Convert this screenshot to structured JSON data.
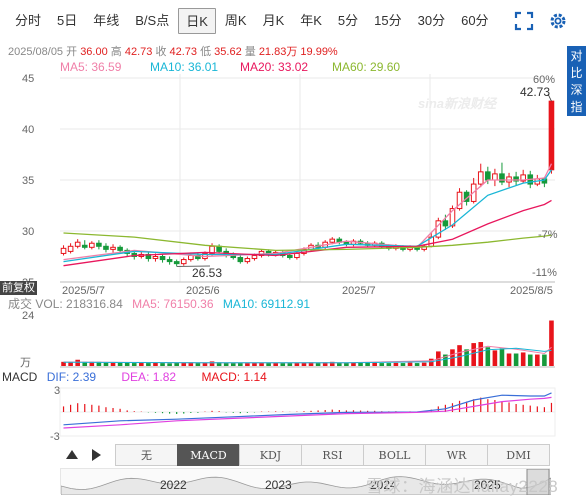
{
  "tabs": [
    {
      "label": "分时"
    },
    {
      "label": "5日"
    },
    {
      "label": "年线"
    },
    {
      "label": "B/S点"
    },
    {
      "label": "日K"
    },
    {
      "label": "周K"
    },
    {
      "label": "月K"
    },
    {
      "label": "年K"
    },
    {
      "label": "5分"
    },
    {
      "label": "15分"
    },
    {
      "label": "30分"
    },
    {
      "label": "60分"
    }
  ],
  "active_tab": "日K",
  "icons": {
    "expand": "expand-icon",
    "settings": "settings-icon",
    "prev": "triangle-up-icon",
    "next": "triangle-right-icon"
  },
  "info": {
    "date": "2025/08/05",
    "open_label": "开",
    "open": "36.00",
    "high_label": "高",
    "high": "42.73",
    "close_label": "收",
    "close": "42.73",
    "low_label": "低",
    "low": "35.62",
    "vol_label": "量",
    "vol": "21.83万",
    "change": "19.99%"
  },
  "ma_legend": [
    {
      "text": "MA5: 36.59",
      "color": "#f07fa8"
    },
    {
      "text": "MA10: 36.01",
      "color": "#19b6d6"
    },
    {
      "text": "MA20: 33.02",
      "color": "#e8175d"
    },
    {
      "text": "MA60: 29.60",
      "color": "#8cb830"
    }
  ],
  "side_button": "对比深指",
  "price_axis": [
    "45",
    "40",
    "35",
    "30",
    "25"
  ],
  "pct_axis": [
    "60%",
    "-7%",
    "-11%"
  ],
  "annotations": {
    "high_label": "42.73",
    "low_label": "26.53",
    "logo_text": "sina新浪财经"
  },
  "date_axis": [
    "2025/5/7",
    "2025/6",
    "2025/7",
    "2025/8/5"
  ],
  "fuquan_label": "前复权",
  "volume_legend": {
    "prefix": "成交",
    "vol": "VOL: 218316.84",
    "ma5": "MA5: 76150.36",
    "ma10": "MA10: 69112.91"
  },
  "volume_axis": {
    "top": "24",
    "unit": "万"
  },
  "macd_legend": {
    "title": "MACD",
    "dif": "DIF: 2.39",
    "dea": "DEA: 1.82",
    "macd": "MACD: 1.14"
  },
  "macd_axis": [
    "3",
    "-3"
  ],
  "indicators": [
    "无",
    "MACD",
    "KDJ",
    "RSI",
    "BOLL",
    "WR",
    "DMI"
  ],
  "active_indicator": "MACD",
  "overview_years": [
    "2022",
    "2023",
    "2024",
    "2025"
  ],
  "watermark": "雪球：海涵达hailay2228",
  "colors": {
    "up": "#e8141b",
    "down": "#169a3b",
    "accent": "#1961b5"
  },
  "chart_data": {
    "type": "candlestick",
    "candles": [
      {
        "o": 27.8,
        "c": 28.3,
        "h": 28.6,
        "l": 27.6
      },
      {
        "o": 28.0,
        "c": 28.5,
        "h": 28.8,
        "l": 27.8
      },
      {
        "o": 28.5,
        "c": 28.9,
        "h": 29.2,
        "l": 28.3
      },
      {
        "o": 28.6,
        "c": 28.4,
        "h": 29.1,
        "l": 28.2
      },
      {
        "o": 28.4,
        "c": 28.8,
        "h": 29.0,
        "l": 28.2
      },
      {
        "o": 28.8,
        "c": 28.5,
        "h": 29.1,
        "l": 28.2
      },
      {
        "o": 28.5,
        "c": 28.2,
        "h": 28.8,
        "l": 27.9
      },
      {
        "o": 28.2,
        "c": 28.4,
        "h": 28.7,
        "l": 27.9
      },
      {
        "o": 28.4,
        "c": 28.1,
        "h": 28.6,
        "l": 27.8
      },
      {
        "o": 28.1,
        "c": 27.8,
        "h": 28.3,
        "l": 27.5
      },
      {
        "o": 27.8,
        "c": 27.5,
        "h": 28.1,
        "l": 27.2
      },
      {
        "o": 27.5,
        "c": 27.7,
        "h": 28.0,
        "l": 27.3
      },
      {
        "o": 27.7,
        "c": 27.3,
        "h": 27.9,
        "l": 27.0
      },
      {
        "o": 27.3,
        "c": 27.5,
        "h": 27.8,
        "l": 27.0
      },
      {
        "o": 27.5,
        "c": 27.2,
        "h": 27.7,
        "l": 26.9
      },
      {
        "o": 27.2,
        "c": 27.0,
        "h": 27.5,
        "l": 26.7
      },
      {
        "o": 27.0,
        "c": 26.8,
        "h": 27.2,
        "l": 26.53
      },
      {
        "o": 26.8,
        "c": 27.2,
        "h": 27.4,
        "l": 26.6
      },
      {
        "o": 27.2,
        "c": 27.6,
        "h": 27.9,
        "l": 27.0
      },
      {
        "o": 27.6,
        "c": 27.3,
        "h": 27.9,
        "l": 27.1
      },
      {
        "o": 27.3,
        "c": 27.8,
        "h": 28.0,
        "l": 27.1
      },
      {
        "o": 27.8,
        "c": 28.5,
        "h": 28.8,
        "l": 27.6
      },
      {
        "o": 28.5,
        "c": 28.0,
        "h": 28.7,
        "l": 27.8
      },
      {
        "o": 28.0,
        "c": 27.6,
        "h": 28.3,
        "l": 27.4
      },
      {
        "o": 27.6,
        "c": 27.4,
        "h": 27.9,
        "l": 27.2
      },
      {
        "o": 27.4,
        "c": 27.0,
        "h": 27.6,
        "l": 26.8
      },
      {
        "o": 27.0,
        "c": 27.3,
        "h": 27.5,
        "l": 26.8
      },
      {
        "o": 27.3,
        "c": 27.6,
        "h": 27.8,
        "l": 27.1
      },
      {
        "o": 27.6,
        "c": 28.0,
        "h": 28.2,
        "l": 27.4
      },
      {
        "o": 28.0,
        "c": 27.7,
        "h": 28.2,
        "l": 27.5
      },
      {
        "o": 27.7,
        "c": 27.9,
        "h": 28.1,
        "l": 27.5
      },
      {
        "o": 27.9,
        "c": 27.6,
        "h": 28.1,
        "l": 27.4
      },
      {
        "o": 27.6,
        "c": 27.4,
        "h": 27.8,
        "l": 27.2
      },
      {
        "o": 27.4,
        "c": 27.8,
        "h": 28.0,
        "l": 27.2
      },
      {
        "o": 27.8,
        "c": 28.2,
        "h": 28.4,
        "l": 27.6
      },
      {
        "o": 28.2,
        "c": 28.6,
        "h": 28.8,
        "l": 28.0
      },
      {
        "o": 28.6,
        "c": 28.4,
        "h": 28.9,
        "l": 28.2
      },
      {
        "o": 28.4,
        "c": 28.9,
        "h": 29.1,
        "l": 28.2
      },
      {
        "o": 28.9,
        "c": 29.2,
        "h": 29.4,
        "l": 28.7
      },
      {
        "o": 29.2,
        "c": 28.9,
        "h": 29.4,
        "l": 28.7
      },
      {
        "o": 28.9,
        "c": 28.7,
        "h": 29.1,
        "l": 28.5
      },
      {
        "o": 28.7,
        "c": 29.0,
        "h": 29.2,
        "l": 28.5
      },
      {
        "o": 29.0,
        "c": 28.8,
        "h": 29.2,
        "l": 28.6
      },
      {
        "o": 28.8,
        "c": 28.6,
        "h": 29.0,
        "l": 28.4
      },
      {
        "o": 28.6,
        "c": 28.8,
        "h": 29.0,
        "l": 28.4
      },
      {
        "o": 28.8,
        "c": 28.5,
        "h": 29.0,
        "l": 28.3
      },
      {
        "o": 28.5,
        "c": 28.3,
        "h": 28.7,
        "l": 28.1
      },
      {
        "o": 28.3,
        "c": 28.5,
        "h": 28.7,
        "l": 28.1
      },
      {
        "o": 28.5,
        "c": 28.2,
        "h": 28.6,
        "l": 28.0
      },
      {
        "o": 28.2,
        "c": 28.4,
        "h": 28.6,
        "l": 28.0
      },
      {
        "o": 28.4,
        "c": 28.2,
        "h": 28.6,
        "l": 28.0
      },
      {
        "o": 28.2,
        "c": 28.5,
        "h": 28.7,
        "l": 28.0
      },
      {
        "o": 28.5,
        "c": 29.4,
        "h": 29.8,
        "l": 28.4
      },
      {
        "o": 29.4,
        "c": 31.0,
        "h": 31.3,
        "l": 29.2
      },
      {
        "o": 31.0,
        "c": 30.5,
        "h": 31.6,
        "l": 30.1
      },
      {
        "o": 30.5,
        "c": 32.2,
        "h": 32.5,
        "l": 30.3
      },
      {
        "o": 32.2,
        "c": 33.8,
        "h": 34.2,
        "l": 32.0
      },
      {
        "o": 33.8,
        "c": 32.9,
        "h": 34.0,
        "l": 32.5
      },
      {
        "o": 32.9,
        "c": 34.6,
        "h": 35.2,
        "l": 32.7
      },
      {
        "o": 34.6,
        "c": 35.8,
        "h": 36.6,
        "l": 34.3
      },
      {
        "o": 35.8,
        "c": 35.0,
        "h": 36.3,
        "l": 34.6
      },
      {
        "o": 35.0,
        "c": 35.6,
        "h": 36.1,
        "l": 34.4
      },
      {
        "o": 35.6,
        "c": 34.8,
        "h": 36.7,
        "l": 34.5
      },
      {
        "o": 34.8,
        "c": 35.3,
        "h": 35.7,
        "l": 34.3
      },
      {
        "o": 35.3,
        "c": 34.9,
        "h": 35.8,
        "l": 34.5
      },
      {
        "o": 34.9,
        "c": 35.5,
        "h": 36.0,
        "l": 34.7
      },
      {
        "o": 35.5,
        "c": 34.6,
        "h": 35.9,
        "l": 34.2
      },
      {
        "o": 34.6,
        "c": 35.1,
        "h": 35.5,
        "l": 34.4
      },
      {
        "o": 35.1,
        "c": 34.7,
        "h": 35.3,
        "l": 34.3
      },
      {
        "o": 36.0,
        "c": 42.73,
        "h": 42.73,
        "l": 35.62
      }
    ],
    "y_range": [
      25,
      45
    ],
    "ma_series": [
      {
        "name": "MA5",
        "values": [
          [
            0,
            27.2
          ],
          [
            10,
            28.1
          ],
          [
            20,
            27.5
          ],
          [
            30,
            27.8
          ],
          [
            40,
            29.0
          ],
          [
            50,
            28.4
          ],
          [
            55,
            32.0
          ],
          [
            60,
            35.0
          ],
          [
            65,
            35.0
          ],
          [
            68,
            35.2
          ],
          [
            69,
            36.6
          ]
        ]
      },
      {
        "name": "MA10",
        "values": [
          [
            0,
            27.0
          ],
          [
            10,
            28.0
          ],
          [
            20,
            27.7
          ],
          [
            30,
            27.7
          ],
          [
            40,
            28.7
          ],
          [
            50,
            28.5
          ],
          [
            55,
            30.6
          ],
          [
            60,
            33.5
          ],
          [
            65,
            34.7
          ],
          [
            68,
            35.0
          ],
          [
            69,
            36.0
          ]
        ]
      },
      {
        "name": "MA20",
        "values": [
          [
            0,
            26.6
          ],
          [
            10,
            27.6
          ],
          [
            20,
            27.9
          ],
          [
            30,
            27.6
          ],
          [
            40,
            28.4
          ],
          [
            50,
            28.5
          ],
          [
            55,
            29.2
          ],
          [
            60,
            30.7
          ],
          [
            65,
            32.0
          ],
          [
            68,
            32.6
          ],
          [
            69,
            33.0
          ]
        ]
      },
      {
        "name": "MA60",
        "values": [
          [
            0,
            29.8
          ],
          [
            10,
            29.4
          ],
          [
            20,
            28.6
          ],
          [
            30,
            28.1
          ],
          [
            40,
            28.2
          ],
          [
            50,
            28.4
          ],
          [
            55,
            28.6
          ],
          [
            60,
            28.9
          ],
          [
            65,
            29.3
          ],
          [
            68,
            29.5
          ],
          [
            69,
            29.6
          ]
        ]
      }
    ],
    "volume_range": [
      0,
      24
    ],
    "volumes": [
      2,
      2,
      3,
      2,
      2,
      2,
      1.6,
      1.6,
      1.5,
      1.5,
      1.4,
      1.5,
      1.4,
      1.5,
      1.4,
      1.3,
      1.6,
      1.6,
      1.8,
      1.5,
      1.7,
      2.2,
      1.8,
      1.5,
      1.4,
      1.5,
      1.4,
      1.5,
      1.7,
      1.5,
      1.5,
      1.4,
      1.4,
      1.5,
      1.7,
      1.8,
      1.5,
      1.8,
      2.0,
      1.6,
      1.5,
      1.7,
      1.5,
      1.5,
      1.6,
      1.4,
      1.4,
      1.5,
      1.4,
      1.6,
      1.4,
      1.6,
      3.5,
      7.0,
      5.5,
      8.0,
      10.0,
      8.0,
      11.0,
      11.5,
      9.0,
      7.5,
      8.5,
      6.0,
      6.0,
      6.5,
      5.5,
      5.5,
      5.5,
      21.83
    ],
    "macd_range": [
      -3,
      3
    ],
    "macd_bars": [
      0.7,
      0.9,
      1.1,
      1.0,
      0.9,
      0.8,
      0.6,
      0.5,
      0.4,
      0.2,
      0.1,
      0.05,
      -0.05,
      -0.1,
      -0.15,
      -0.2,
      -0.25,
      -0.2,
      -0.12,
      -0.1,
      0.05,
      0.15,
      0.1,
      -0.05,
      -0.1,
      -0.15,
      -0.1,
      -0.05,
      0.05,
      0.05,
      0.08,
      0.05,
      0.02,
      0.05,
      0.1,
      0.15,
      0.2,
      0.25,
      0.3,
      0.25,
      0.2,
      0.22,
      0.18,
      0.15,
      0.15,
      0.1,
      0.08,
      0.1,
      0.05,
      0.08,
      0.05,
      0.1,
      0.3,
      0.7,
      0.9,
      1.1,
      1.4,
      1.3,
      1.6,
      1.8,
      1.6,
      1.5,
      1.3,
      1.2,
      1.0,
      0.9,
      0.8,
      0.7,
      0.6,
      1.14
    ],
    "dif": [
      [
        0,
        -1.6
      ],
      [
        8,
        -1.1
      ],
      [
        16,
        -0.9
      ],
      [
        24,
        -0.6
      ],
      [
        32,
        -0.3
      ],
      [
        40,
        -0.05
      ],
      [
        50,
        0.0
      ],
      [
        54,
        0.4
      ],
      [
        58,
        1.5
      ],
      [
        62,
        2.1
      ],
      [
        66,
        2.0
      ],
      [
        68,
        2.0
      ],
      [
        69,
        2.39
      ]
    ],
    "dea": [
      [
        0,
        -2.0
      ],
      [
        8,
        -1.6
      ],
      [
        16,
        -1.1
      ],
      [
        24,
        -0.8
      ],
      [
        32,
        -0.5
      ],
      [
        40,
        -0.2
      ],
      [
        50,
        -0.05
      ],
      [
        54,
        0.1
      ],
      [
        58,
        0.7
      ],
      [
        62,
        1.3
      ],
      [
        66,
        1.6
      ],
      [
        68,
        1.7
      ],
      [
        69,
        1.82
      ]
    ]
  }
}
